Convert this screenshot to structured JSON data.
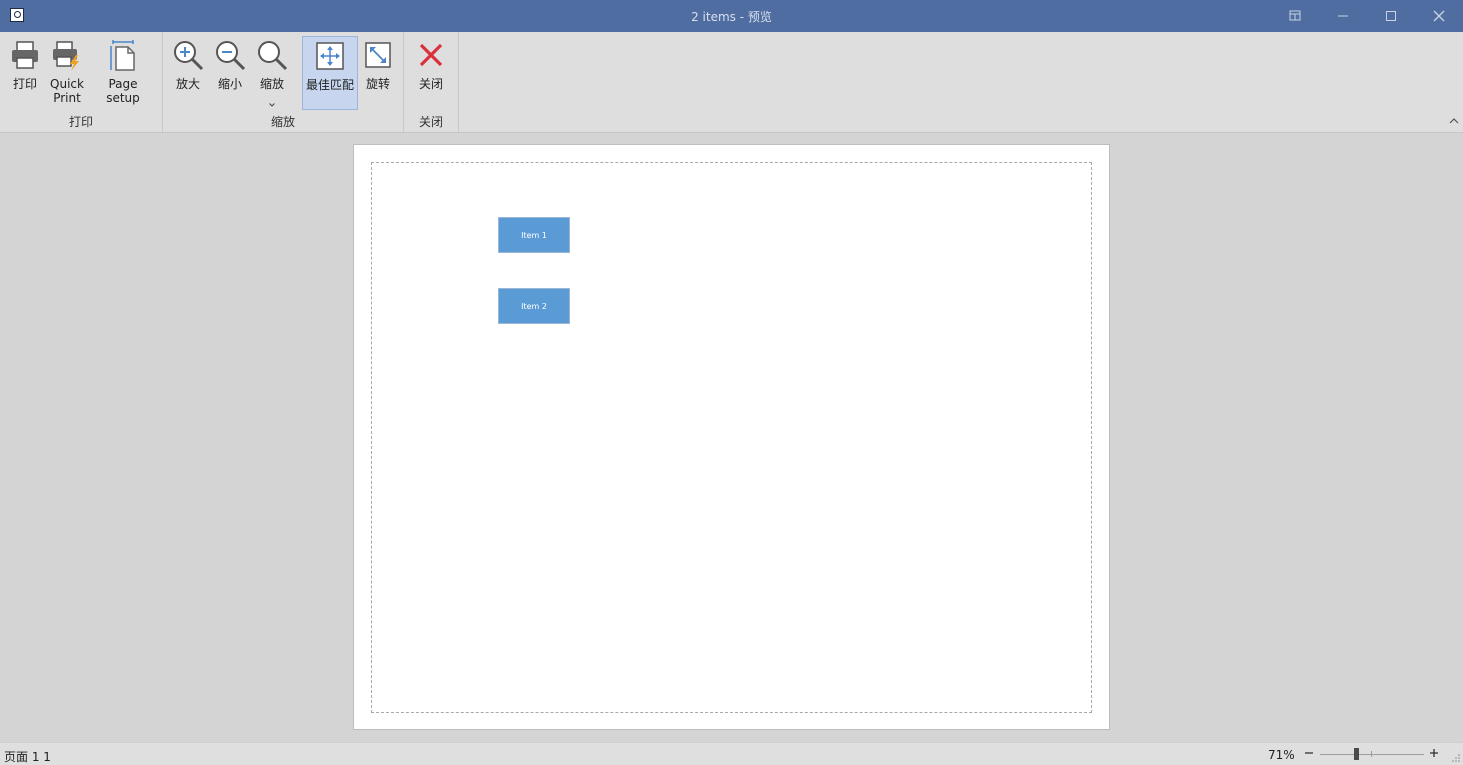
{
  "window": {
    "title": "2 items - 预览"
  },
  "ribbon": {
    "groups": {
      "print": {
        "label": "打印",
        "buttons": {
          "print": "打印",
          "quick_print": "Quick\nPrint",
          "page_setup": "Page setup"
        }
      },
      "zoom": {
        "label": "缩放",
        "buttons": {
          "zoom_in": "放大",
          "zoom_out": "缩小",
          "zoom": "缩放",
          "best_fit": "最佳匹配",
          "rotate": "旋转"
        }
      },
      "close": {
        "label": "关闭",
        "buttons": {
          "close": "关闭"
        }
      }
    }
  },
  "preview": {
    "items": [
      "Item 1",
      "Item 2"
    ],
    "item_color": "#5b9bd5"
  },
  "status": {
    "page_info": "页面 1 1",
    "zoom_level": "71%"
  },
  "colors": {
    "titlebar": "#4f6da0",
    "accent_active": "#c7d6ee",
    "close_icon": "#d9303c",
    "icon_blue": "#4a86c8"
  }
}
